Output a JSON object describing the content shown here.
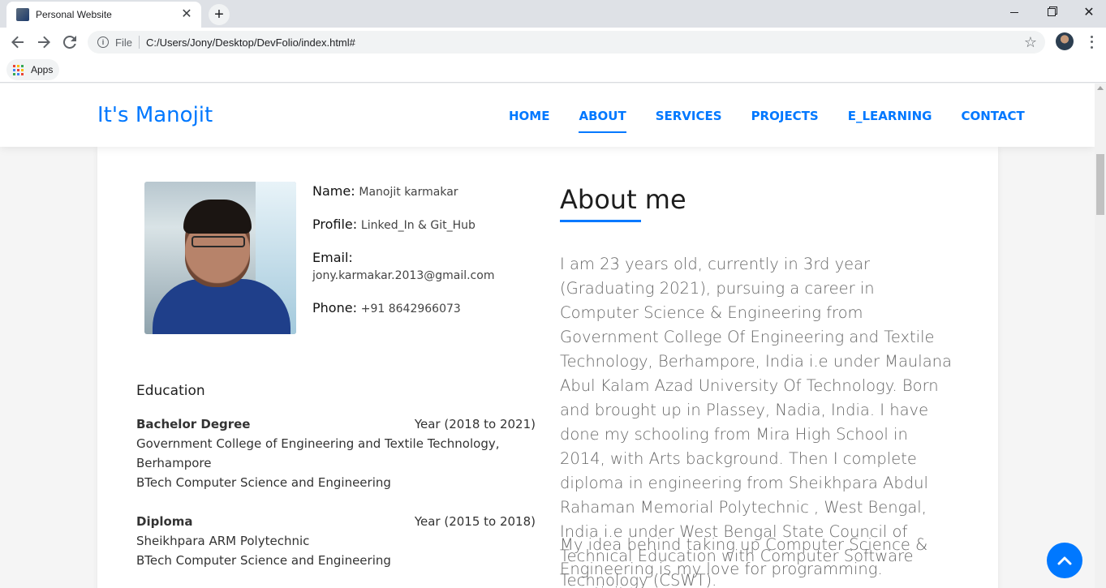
{
  "browser": {
    "tab_title": "Personal Website",
    "tab_close": "✕",
    "new_tab": "+",
    "omnibox_scheme": "File",
    "omnibox_url": "C:/Users/Jony/Desktop/DevFolio/index.html#",
    "bookmark_apps": "Apps",
    "window_close": "✕"
  },
  "site": {
    "brand": "It's Manojit",
    "nav": [
      "HOME",
      "ABOUT",
      "SERVICES",
      "PROJECTS",
      "E_LEARNING",
      "CONTACT"
    ],
    "active_nav": "ABOUT"
  },
  "profile": {
    "name_label": "Name:",
    "name_value": "Manojit karmakar",
    "profile_label": "Profile:",
    "profile_value": "Linked_In & Git_Hub",
    "email_label": "Email:",
    "email_value": "jony.karmakar.2013@gmail.com",
    "phone_label": "Phone:",
    "phone_value": "+91 8642966073"
  },
  "education": {
    "title": "Education",
    "items": [
      {
        "degree": "Bachelor Degree",
        "year": "Year (2018 to 2021)",
        "lines": [
          "Government College of Engineering and Textile Technology,",
          "Berhampore",
          "BTech Computer Science and Engineering"
        ]
      },
      {
        "degree": "Diploma",
        "year": "Year (2015 to 2018)",
        "lines": [
          "Sheikhpara ARM Polytechnic",
          "BTech Computer Science and Engineering"
        ]
      }
    ]
  },
  "about": {
    "title": "About me",
    "paragraphs": [
      "I am 23 years old, currently in 3rd year (Graduating 2021), pursuing a career in Computer Science & Engineering from Government College Of Engineering and Textile Technology, Berhampore, India i.e under Maulana Abul Kalam Azad University Of Technology. Born and brought up in Plassey, Nadia, India. I have done my schooling from Mira High School in 2014, with Arts background. Then I complete diploma in engineering from Sheikhpara Abdul Rahaman Memorial Polytechnic , West Bengal, India i.e under West Bengal State Council of Technical Education with Computer Software Technology (CSWT).",
      "My idea behind taking up Computer Science & Engineering is my love for programming. creativity on"
    ]
  },
  "colors": {
    "accent": "#0078ff",
    "body_text": "#666666"
  }
}
